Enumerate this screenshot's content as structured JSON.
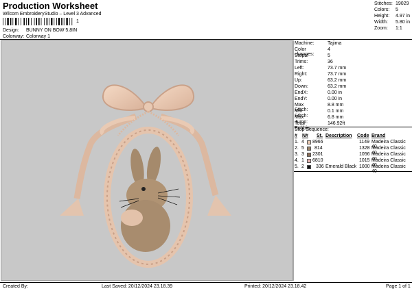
{
  "header": {
    "title": "Production Worksheet",
    "subtitle": "Wilcom EmbroideryStudio – Level 3 Advanced",
    "barcode_suffix": "1",
    "design_label": "Design:",
    "design_value": "BUNNY ON BOW 5,8IN",
    "colorway_label": "Colorway:",
    "colorway_value": "Colorway 1"
  },
  "summary": [
    {
      "label": "Stitches:",
      "value": "19029"
    },
    {
      "label": "Colors:",
      "value": "5"
    },
    {
      "label": "Height:",
      "value": "4.97 in"
    },
    {
      "label": "Width:",
      "value": "5.80 in"
    },
    {
      "label": "Zoom:",
      "value": "1:1"
    }
  ],
  "machine_info": [
    {
      "label": "Machine:",
      "value": "Tajima"
    },
    {
      "label": "Color changes:",
      "value": "4"
    },
    {
      "label": "Stops:",
      "value": "5"
    },
    {
      "label": "Trims:",
      "value": "36"
    },
    {
      "label": "Left:",
      "value": "73.7 mm"
    },
    {
      "label": "Right:",
      "value": "73.7 mm"
    },
    {
      "label": "Up:",
      "value": "63.2 mm"
    },
    {
      "label": "Down:",
      "value": "63.2 mm"
    },
    {
      "label": "EndX:",
      "value": "0.00 in"
    },
    {
      "label": "EndY:",
      "value": "0.00 in"
    },
    {
      "label": "Max Stitch:",
      "value": "8.8 mm"
    },
    {
      "label": "Min Stitch:",
      "value": "0.1 mm"
    },
    {
      "label": "Max Jump:",
      "value": "6.8 mm"
    },
    {
      "label": "Total Bobbin:",
      "value": "146.92ft"
    }
  ],
  "stop_sequence": {
    "heading": "Stop Sequence:",
    "columns": {
      "num": "#",
      "n": "N#",
      "st": "St.",
      "desc": "Description",
      "code": "Code",
      "brand": "Brand"
    },
    "rows": [
      {
        "num": "1.",
        "n": "4",
        "color": "#e8c9b3",
        "st": "8966",
        "desc": "",
        "code": "1149",
        "brand": "Madeira Classic 40"
      },
      {
        "num": "2.",
        "n": "5",
        "color": "#9a826a",
        "st": "814",
        "desc": "",
        "code": "1328",
        "brand": "Madeira Classic 40"
      },
      {
        "num": "3.",
        "n": "3",
        "color": "#8a6e5a",
        "st": "2301",
        "desc": "",
        "code": "1056",
        "brand": "Madeira Classic 40"
      },
      {
        "num": "4.",
        "n": "1",
        "color": "#e8b4b0",
        "st": "6810",
        "desc": "",
        "code": "1015",
        "brand": "Madeira Classic 40"
      },
      {
        "num": "5.",
        "n": "2",
        "color": "#111111",
        "st": "336",
        "desc": "Emerald Black",
        "code": "1000",
        "brand": "Madeira Classic 40"
      }
    ]
  },
  "footer": {
    "created_by": "Created By:",
    "last_saved": "Last Saved: 20/12/2024 23.18.39",
    "printed": "Printed: 20/12/2024 23.18.42",
    "page": "Page 1 of 1"
  }
}
